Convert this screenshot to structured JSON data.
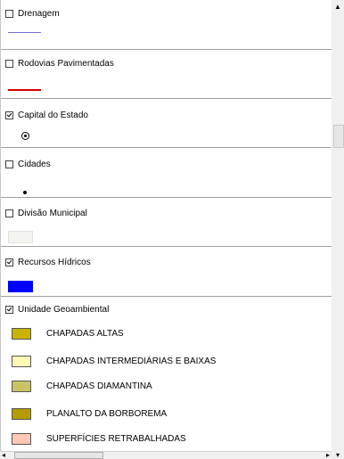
{
  "layers": [
    {
      "label": "Drenagem",
      "checked": false,
      "symbol": "line",
      "color": "#6f6fd8"
    },
    {
      "label": "Rodovias Pavimentadas",
      "checked": false,
      "symbol": "line",
      "color": "#d00000"
    },
    {
      "label": "Capital do Estado",
      "checked": true,
      "symbol": "circle-dot",
      "color": "#000000"
    },
    {
      "label": "Cidades",
      "checked": false,
      "symbol": "dot",
      "color": "#000000"
    },
    {
      "label": "Divisão Municipal",
      "checked": false,
      "symbol": "box",
      "color": "#f5f5f0"
    },
    {
      "label": "Recursos Hídricos",
      "checked": true,
      "symbol": "box",
      "color": "#0000ff"
    },
    {
      "label": "Unidade Geoambiental",
      "checked": true,
      "symbol": "legend"
    }
  ],
  "geo_units": [
    {
      "label": "CHAPADAS ALTAS",
      "color": "#c8b400"
    },
    {
      "label": "CHAPADAS INTERMEDIÁRIAS E BAIXAS",
      "color": "#fff8b4"
    },
    {
      "label": "CHAPADAS DIAMANTINA",
      "color": "#c8c464"
    },
    {
      "label": "PLANALTO DA BORBOREMA",
      "color": "#b49c00"
    },
    {
      "label": "SUPERFÍCIES RETRABALHADAS",
      "color": "#ffc8b4"
    }
  ]
}
